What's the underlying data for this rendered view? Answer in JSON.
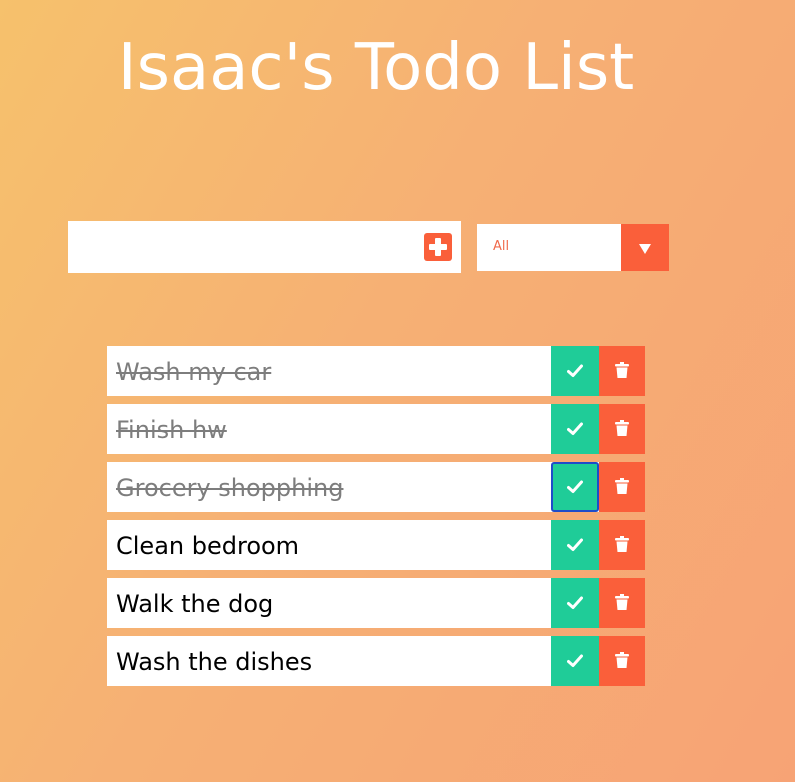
{
  "header": {
    "title": "Isaac's Todo List"
  },
  "form": {
    "input_value": "",
    "add_icon": "plus-square-icon"
  },
  "filter": {
    "selected": "All",
    "arrow_icon": "caret-down-icon"
  },
  "todos": [
    {
      "text": "Wash my car",
      "completed": true
    },
    {
      "text": "Finish hw",
      "completed": true
    },
    {
      "text": "Grocery shopphing",
      "completed": true
    },
    {
      "text": "Clean bedroom",
      "completed": false
    },
    {
      "text": "Walk the dog",
      "completed": false
    },
    {
      "text": "Wash the dishes",
      "completed": false
    }
  ],
  "icons": {
    "complete": "check-icon",
    "delete": "trash-icon"
  },
  "colors": {
    "accent": "#fa5f3a",
    "complete": "#1fcc98",
    "focus_ring": "#1f4cc9",
    "gradient_start": "#f6c16c",
    "gradient_end": "#f7a375"
  }
}
